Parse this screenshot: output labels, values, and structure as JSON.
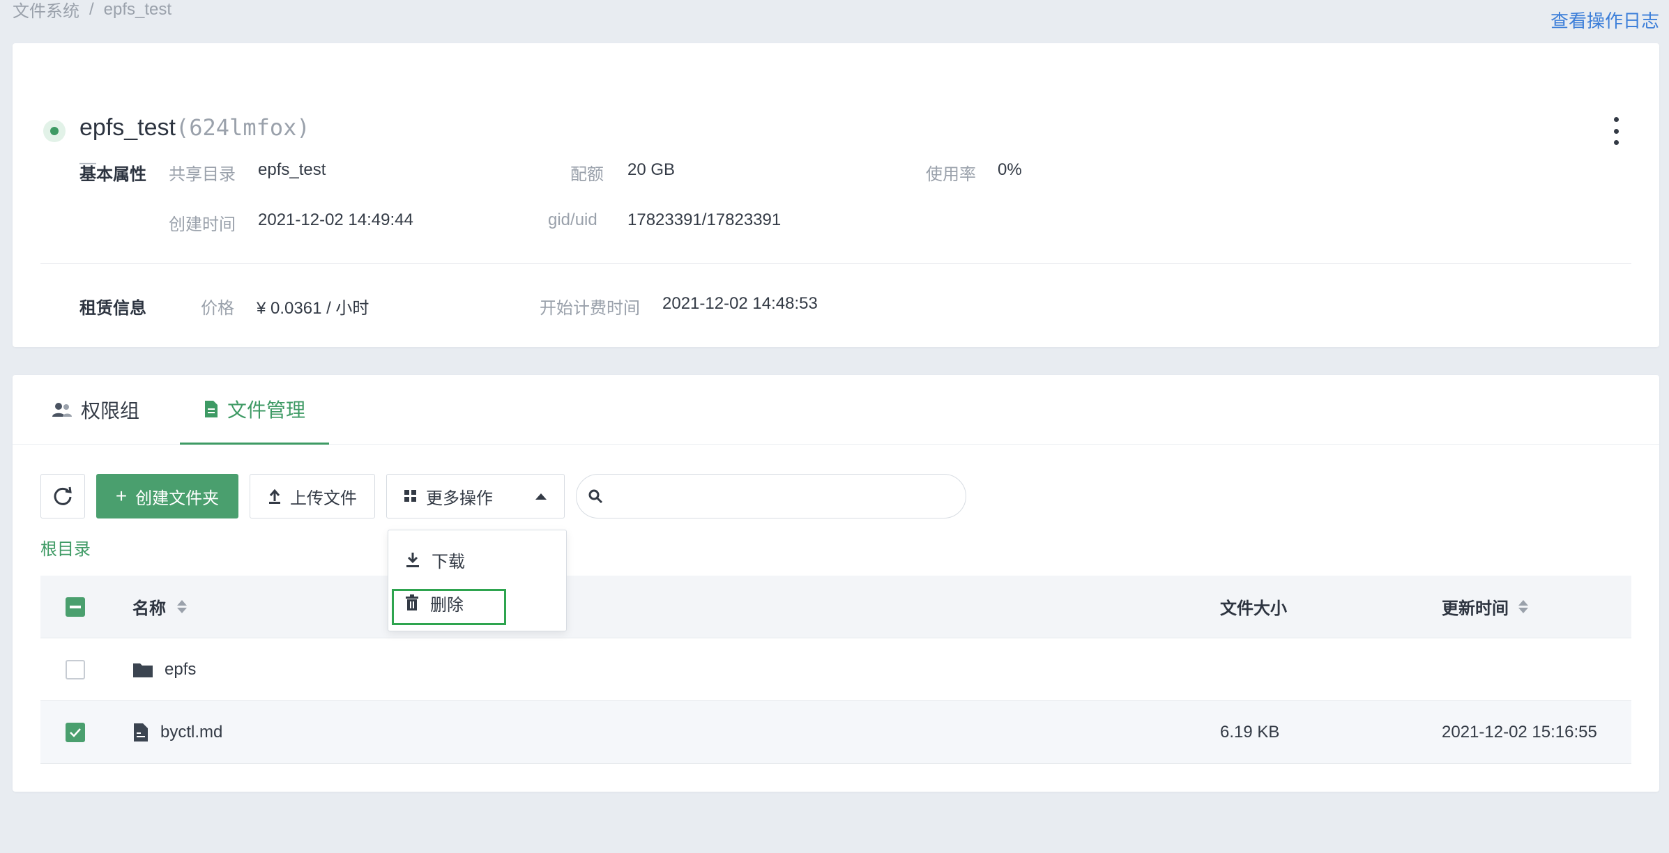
{
  "breadcrumb": {
    "root": "文件系统",
    "separator": "/",
    "current": "epfs_test"
  },
  "top_link": "查看操作日志",
  "filesystem": {
    "name": "epfs_test",
    "id": "(624lmfox)",
    "description": "—"
  },
  "basic": {
    "section": "基本属性",
    "share_dir_label": "共享目录",
    "share_dir_value": "epfs_test",
    "quota_label": "配额",
    "quota_value": "20 GB",
    "usage_label": "使用率",
    "usage_value": "0%",
    "created_label": "创建时间",
    "created_value": "2021-12-02 14:49:44",
    "gid_label": "gid/uid",
    "gid_value": "17823391/17823391"
  },
  "lease": {
    "section": "租赁信息",
    "price_label": "价格",
    "price_value": "¥ 0.0361 / 小时",
    "billing_label": "开始计费时间",
    "billing_value": "2021-12-02 14:48:53"
  },
  "tabs": [
    {
      "label": "权限组",
      "icon": "users-icon"
    },
    {
      "label": "文件管理",
      "icon": "document-icon",
      "active": true
    }
  ],
  "toolbar": {
    "create_label": "创建文件夹",
    "upload_label": "上传文件",
    "more_label": "更多操作",
    "search_placeholder": ""
  },
  "root_dir": "根目录",
  "table": {
    "headers": {
      "name": "名称",
      "size": "文件大小",
      "updated": "更新时间"
    },
    "rows": [
      {
        "type": "folder",
        "name": "epfs",
        "size": "",
        "updated": "",
        "checked": false
      },
      {
        "type": "file",
        "name": "byctl.md",
        "size": "6.19 KB",
        "updated": "2021-12-02 15:16:55",
        "checked": true
      }
    ]
  },
  "dropdown": {
    "download_label": "下载",
    "delete_label": "删除"
  },
  "colors": {
    "accent": "#4a9f6e",
    "link": "#3d7fd9",
    "highlight": "#2ea44f"
  }
}
